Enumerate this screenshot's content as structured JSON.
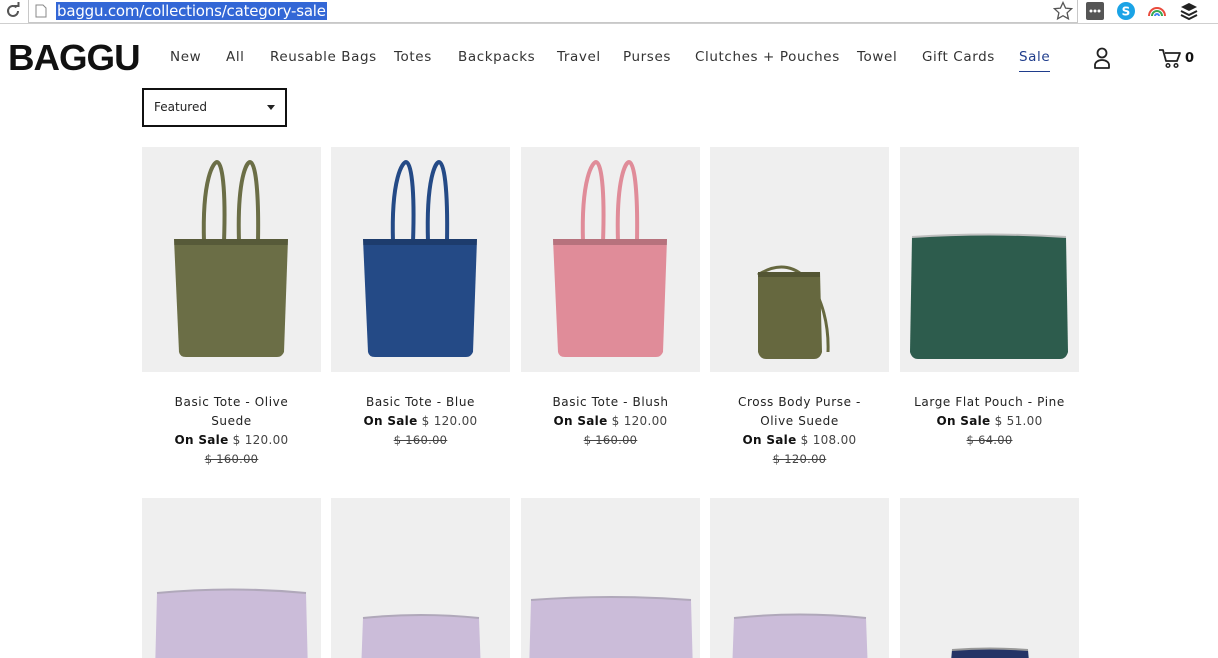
{
  "browser": {
    "url": "baggu.com/collections/category-sale"
  },
  "header": {
    "logo": "BAGGU",
    "nav": [
      {
        "label": "New",
        "active": false
      },
      {
        "label": "All",
        "active": false
      },
      {
        "label": "Reusable Bags",
        "active": false
      },
      {
        "label": "Totes",
        "active": false
      },
      {
        "label": "Backpacks",
        "active": false
      },
      {
        "label": "Travel",
        "active": false
      },
      {
        "label": "Purses",
        "active": false
      },
      {
        "label": "Clutches + Pouches",
        "active": false
      },
      {
        "label": "Towel",
        "active": false
      },
      {
        "label": "Gift Cards",
        "active": false
      },
      {
        "label": "Sale",
        "active": true
      }
    ],
    "cart_count": "0"
  },
  "sort": {
    "selected": "Featured"
  },
  "sale_label": "On Sale",
  "products": [
    {
      "title": "Basic Tote - Olive Suede",
      "price": "$ 120.00",
      "old_price": "$ 160.00",
      "color": "#6b6e46",
      "shape": "tote"
    },
    {
      "title": "Basic Tote - Blue",
      "price": "$ 120.00",
      "old_price": "$ 160.00",
      "color": "#244a86",
      "shape": "tote"
    },
    {
      "title": "Basic Tote - Blush",
      "price": "$ 120.00",
      "old_price": "$ 160.00",
      "color": "#e08c99",
      "shape": "tote"
    },
    {
      "title": "Cross Body Purse - Olive Suede",
      "price": "$ 108.00",
      "old_price": "$ 120.00",
      "color": "#66683f",
      "shape": "crossbody"
    },
    {
      "title": "Large Flat Pouch - Pine",
      "price": "$ 51.00",
      "old_price": "$ 64.00",
      "color": "#2d5c4d",
      "shape": "pouch"
    }
  ],
  "products_row2": [
    {
      "color": "#cbbcd9",
      "shape": "pouch-lg"
    },
    {
      "color": "#cbbcd9",
      "shape": "pouch-md"
    },
    {
      "color": "#cbbcd9",
      "shape": "pouch-xl"
    },
    {
      "color": "#cbbcd9",
      "shape": "pouch-md2"
    },
    {
      "color": "#253466",
      "shape": "pouch-sm"
    }
  ]
}
